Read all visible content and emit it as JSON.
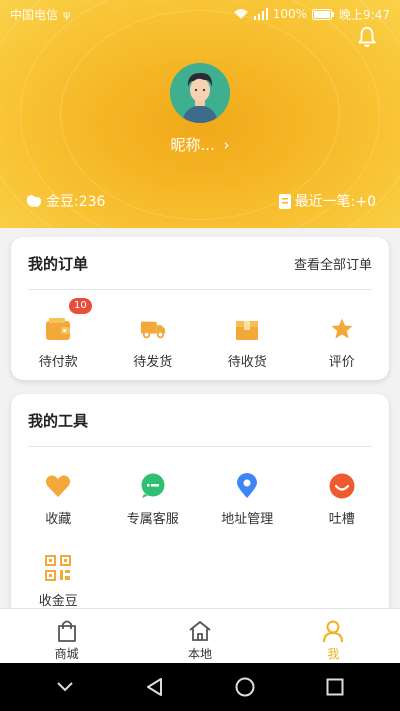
{
  "status_bar": {
    "carrier": "中国电信",
    "battery": "100%",
    "time": "晚上9:47"
  },
  "profile": {
    "nickname": "昵称...",
    "beans_label": "金豆:236",
    "latest_label": "最近一笔:+0"
  },
  "orders": {
    "title": "我的订单",
    "view_all": "查看全部订单",
    "items": [
      {
        "label": "待付款",
        "badge": "10",
        "icon": "wallet-icon"
      },
      {
        "label": "待发货",
        "icon": "truck-icon"
      },
      {
        "label": "待收货",
        "icon": "package-icon"
      },
      {
        "label": "评价",
        "icon": "star-icon"
      }
    ]
  },
  "tools": {
    "title": "我的工具",
    "items": [
      {
        "label": "收藏",
        "icon": "heart-icon"
      },
      {
        "label": "专属客服",
        "icon": "chat-icon"
      },
      {
        "label": "地址管理",
        "icon": "location-pin-icon"
      },
      {
        "label": "吐槽",
        "icon": "smile-icon"
      },
      {
        "label": "收金豆",
        "icon": "qr-code-icon"
      }
    ]
  },
  "bottom_nav": {
    "items": [
      {
        "label": "商城",
        "icon": "shopping-bag-icon"
      },
      {
        "label": "本地",
        "icon": "home-icon"
      },
      {
        "label": "我",
        "icon": "user-icon",
        "active": true
      }
    ]
  },
  "colors": {
    "accent": "#f2b01d",
    "badge": "#e84e3c",
    "chat_green": "#2fbf71",
    "pin_blue": "#3d86f5",
    "smile_red": "#ef5a2e"
  }
}
